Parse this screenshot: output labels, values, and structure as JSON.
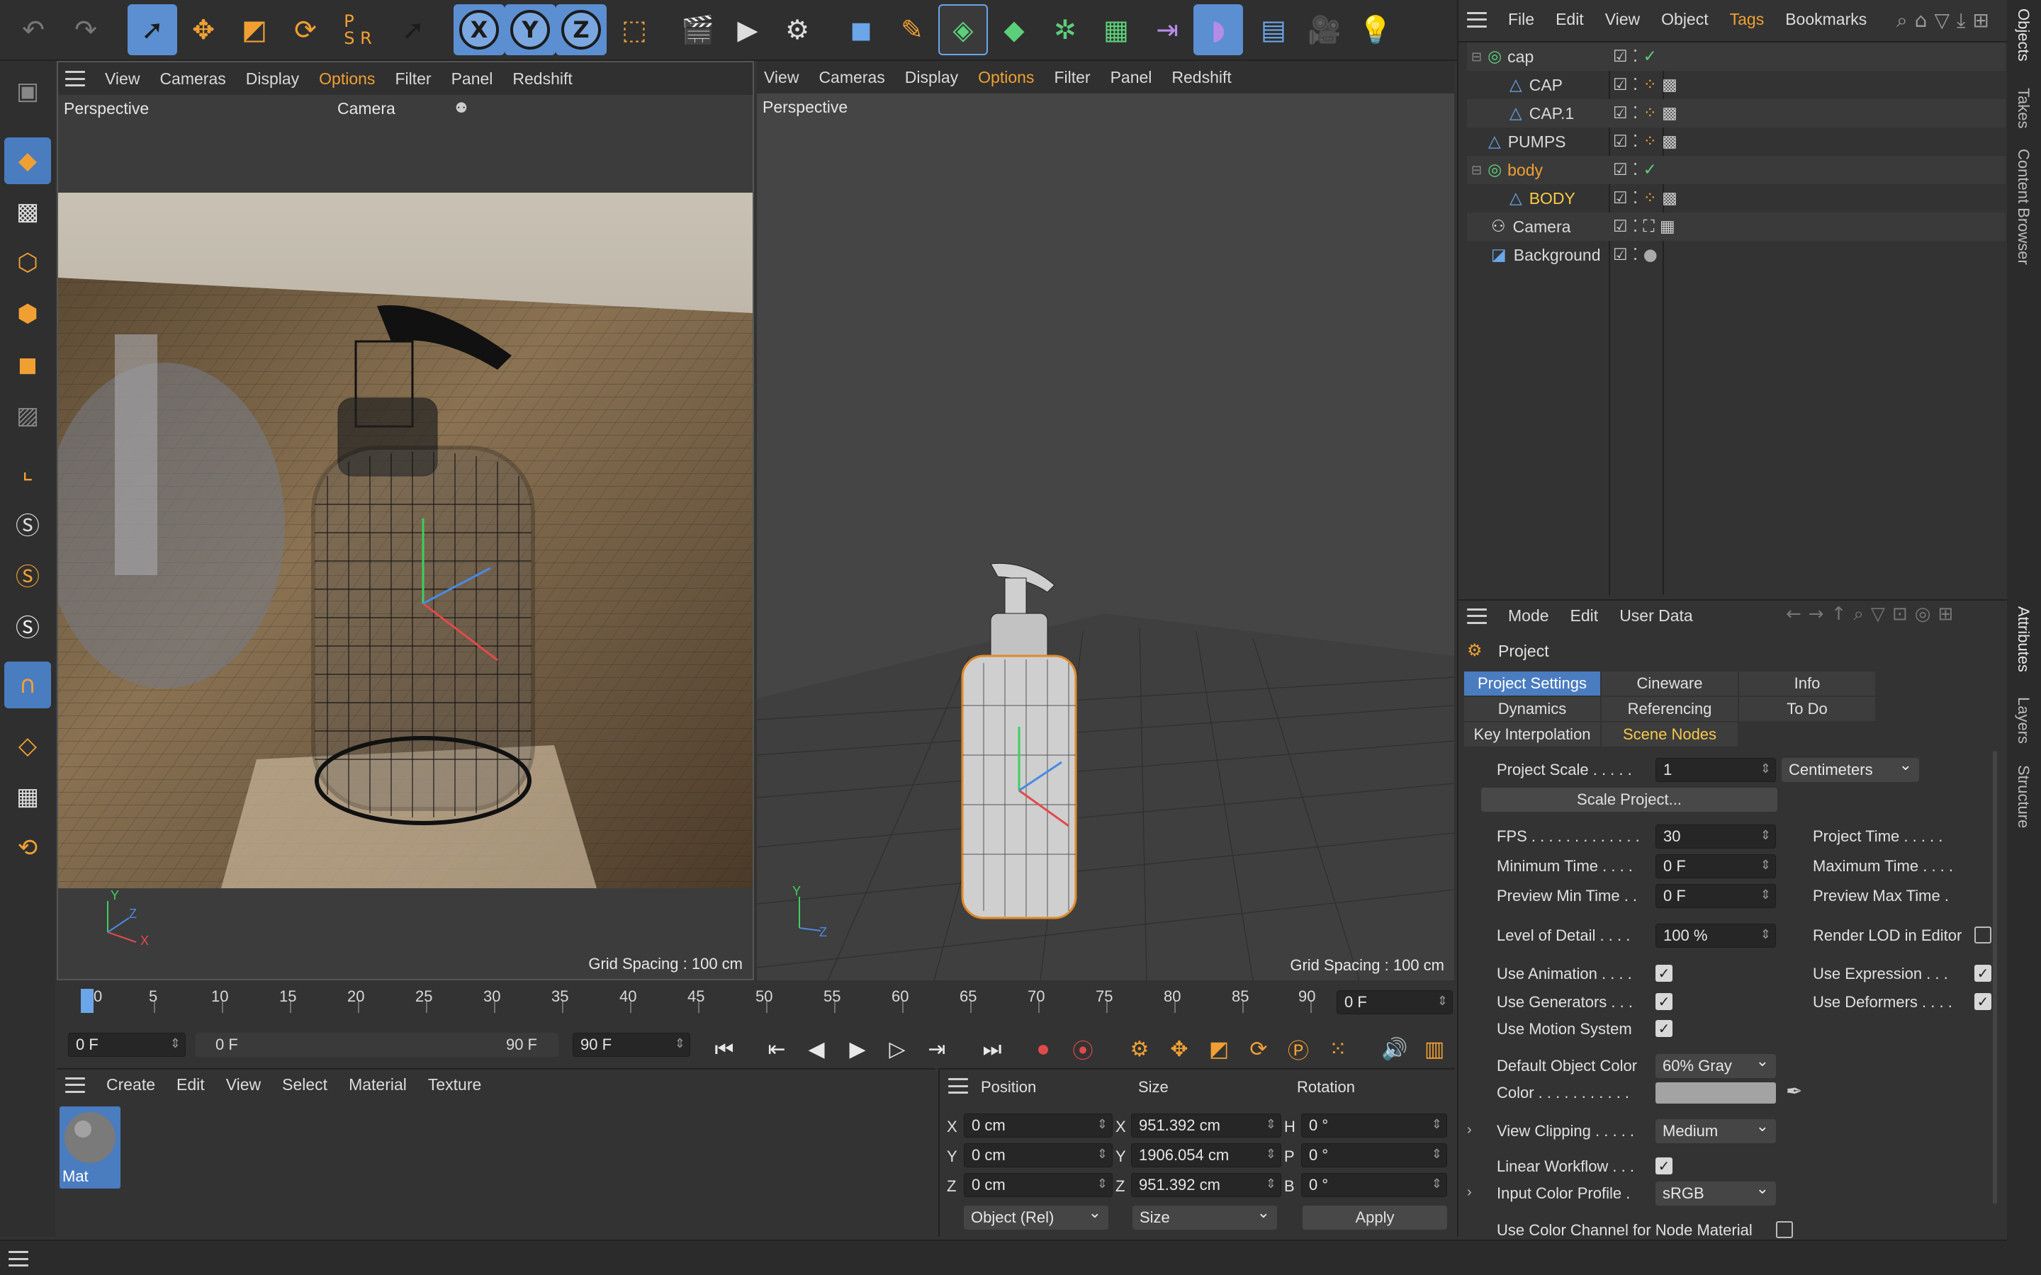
{
  "viewport_left": {
    "menu": [
      "View",
      "Cameras",
      "Display",
      "Options",
      "Filter",
      "Panel",
      "Redshift"
    ],
    "highlight": "Options",
    "label": "Perspective",
    "camera_label": "Camera",
    "grid_spacing": "Grid Spacing : 100 cm"
  },
  "viewport_right": {
    "menu": [
      "View",
      "Cameras",
      "Display",
      "Options",
      "Filter",
      "Panel",
      "Redshift"
    ],
    "highlight": "Options",
    "label": "Perspective",
    "grid_spacing": "Grid Spacing : 100 cm"
  },
  "objects_panel": {
    "menu": [
      "File",
      "Edit",
      "View",
      "Object",
      "Tags",
      "Bookmarks"
    ],
    "highlight": "Tags",
    "items": [
      {
        "name": "cap",
        "color": "#d8d8d8"
      },
      {
        "name": "CAP",
        "color": "#d8d8d8"
      },
      {
        "name": "CAP.1",
        "color": "#d8d8d8"
      },
      {
        "name": "PUMPS",
        "color": "#d8d8d8"
      },
      {
        "name": "body",
        "color": "#f0a033"
      },
      {
        "name": "BODY",
        "color": "#f7c948"
      },
      {
        "name": "Camera",
        "color": "#d8d8d8"
      },
      {
        "name": "Background",
        "color": "#d8d8d8"
      }
    ],
    "side_tabs": [
      "Objects",
      "Takes",
      "Content Browser"
    ]
  },
  "attributes": {
    "menu": [
      "Mode",
      "Edit",
      "User Data"
    ],
    "title": "Project",
    "tabs": [
      "Project Settings",
      "Cineware",
      "Info",
      "Dynamics",
      "Referencing",
      "To Do",
      "Key Interpolation",
      "Scene Nodes"
    ],
    "selected_tab": "Project Settings",
    "project_scale_label": "Project Scale . . . . .",
    "project_scale_value": "1",
    "project_scale_unit": "Centimeters",
    "scale_project_button": "Scale Project...",
    "fps_label": "FPS . . . . . . . . . . . . .",
    "fps_value": "30",
    "project_time_label": "Project Time  . . . . .",
    "min_time_label": "Minimum Time . . . .",
    "min_time_value": "0 F",
    "max_time_label": "Maximum Time . . . .",
    "preview_min_label": "Preview Min Time . .",
    "preview_min_value": "0 F",
    "preview_max_label": "Preview Max Time  .",
    "lod_label": "Level of Detail  . . . .",
    "lod_value": "100 %",
    "render_lod_label": "Render LOD in Editor",
    "use_animation_label": "Use Animation . . . .",
    "use_expression_label": "Use Expression  . . .",
    "use_generators_label": "Use Generators . . .",
    "use_deformers_label": "Use Deformers . . . .",
    "use_motion_label": "Use Motion System",
    "default_color_label": "Default Object Color",
    "default_color_value": "60% Gray",
    "color_label": "Color . . . . . . . . . . .",
    "view_clipping_label": "View Clipping  . . . . .",
    "view_clipping_value": "Medium",
    "linear_workflow_label": "Linear Workflow . . .",
    "input_color_label": "Input Color Profile  .",
    "input_color_value": "sRGB",
    "node_material_label": "Use Color Channel for Node Material",
    "side_tabs": [
      "Attributes",
      "Layers",
      "Structure"
    ]
  },
  "timeline": {
    "ticks": [
      "0",
      "5",
      "10",
      "15",
      "20",
      "25",
      "30",
      "35",
      "40",
      "45",
      "50",
      "55",
      "60",
      "65",
      "70",
      "75",
      "80",
      "85",
      "90"
    ],
    "current_frame": "0 F",
    "start": "0 F",
    "range_start": "0 F",
    "range_end": "90 F",
    "end": "90 F"
  },
  "material_manager": {
    "menu": [
      "Create",
      "Edit",
      "View",
      "Select",
      "Material",
      "Texture"
    ],
    "material_name": "Mat"
  },
  "coordinates": {
    "headers": [
      "Position",
      "Size",
      "Rotation"
    ],
    "rows": [
      {
        "axis": "X",
        "pos": "0 cm",
        "saxis": "X",
        "size": "951.392 cm",
        "raxis": "H",
        "rot": "0 °"
      },
      {
        "axis": "Y",
        "pos": "0 cm",
        "saxis": "Y",
        "size": "1906.054 cm",
        "raxis": "P",
        "rot": "0 °"
      },
      {
        "axis": "Z",
        "pos": "0 cm",
        "saxis": "Z",
        "size": "951.392 cm",
        "raxis": "B",
        "rot": "0 °"
      }
    ],
    "mode": "Object (Rel)",
    "size_mode": "Size",
    "apply": "Apply"
  }
}
